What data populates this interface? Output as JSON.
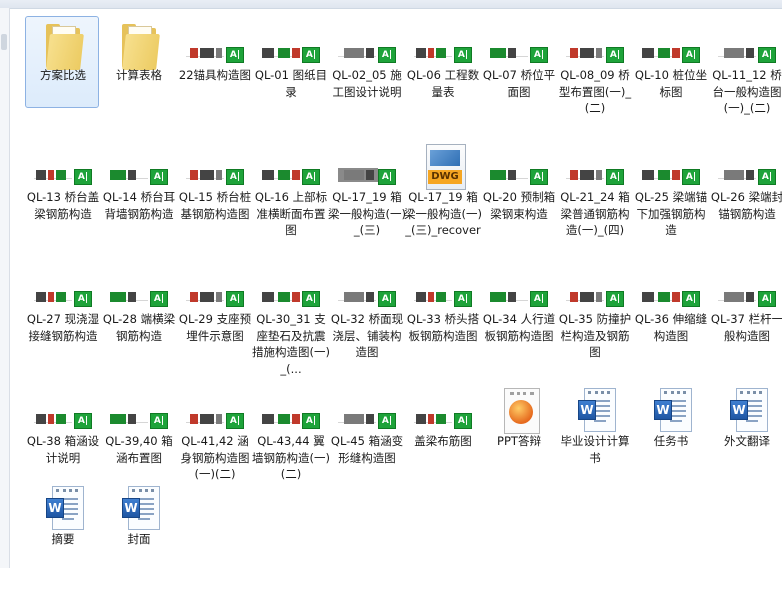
{
  "window": {
    "title": ""
  },
  "items": [
    {
      "label": "方案比选",
      "type": "folder",
      "selected": true
    },
    {
      "label": "计算表格",
      "type": "folder"
    },
    {
      "label": "22锚具构造图",
      "type": "drawing"
    },
    {
      "label": "QL-01 图纸目录",
      "type": "drawing"
    },
    {
      "label": "QL-02_05 施工图设计说明",
      "type": "drawing"
    },
    {
      "label": "QL-06 工程数量表",
      "type": "drawing"
    },
    {
      "label": "QL-07 桥位平面图",
      "type": "drawing"
    },
    {
      "label": "QL-08_09 桥型布置图(一)_(二)",
      "type": "drawing"
    },
    {
      "label": "QL-10 桩位坐标图",
      "type": "drawing"
    },
    {
      "label": "QL-11_12 桥台一般构造图(一)_(二)",
      "type": "drawing"
    },
    {
      "label": "QL-13 桥台盖梁钢筋构造",
      "type": "drawing"
    },
    {
      "label": "QL-14 桥台耳背墙钢筋构造",
      "type": "drawing"
    },
    {
      "label": "QL-15 桥台桩基钢筋构造图",
      "type": "drawing"
    },
    {
      "label": "QL-16 上部标准横断面布置图",
      "type": "drawing"
    },
    {
      "label": "QL-17_19 箱梁一般构造(一)_(三)",
      "type": "drawing"
    },
    {
      "label": "QL-17_19 箱梁一般构造(一)_(三)_recover",
      "type": "dwg",
      "badge": "DWG"
    },
    {
      "label": "QL-20 预制箱梁钢束构造",
      "type": "drawing"
    },
    {
      "label": "QL-21_24 箱梁普通钢筋构造(一)_(四)",
      "type": "drawing"
    },
    {
      "label": "QL-25 梁端锚下加强钢筋构造",
      "type": "drawing"
    },
    {
      "label": "QL-26 梁端封锚钢筋构造",
      "type": "drawing"
    },
    {
      "label": "QL-27 现浇湿接缝钢筋构造",
      "type": "drawing"
    },
    {
      "label": "QL-28 端横梁钢筋构造",
      "type": "drawing"
    },
    {
      "label": "QL-29 支座预埋件示意图",
      "type": "drawing"
    },
    {
      "label": "QL-30_31 支座垫石及抗震措施构造图(一)_(...",
      "type": "drawing"
    },
    {
      "label": "QL-32 桥面现浇层、铺装构造图",
      "type": "drawing"
    },
    {
      "label": "QL-33 桥头搭板钢筋构造图",
      "type": "drawing"
    },
    {
      "label": "QL-34 人行道板钢筋构造图",
      "type": "drawing"
    },
    {
      "label": "QL-35 防撞护栏构造及钢筋图",
      "type": "drawing"
    },
    {
      "label": "QL-36 伸缩缝构造图",
      "type": "drawing"
    },
    {
      "label": "QL-37 栏杆一般构造图",
      "type": "drawing"
    },
    {
      "label": "QL-38 箱涵设计说明",
      "type": "drawing"
    },
    {
      "label": "QL-39,40 箱涵布置图",
      "type": "drawing"
    },
    {
      "label": "QL-41,42 涵身钢筋构造图(一)(二)",
      "type": "drawing"
    },
    {
      "label": "QL-43,44 翼墙钢筋构造(一)(二)",
      "type": "drawing"
    },
    {
      "label": "QL-45 箱涵变形缝构造图",
      "type": "drawing"
    },
    {
      "label": "盖梁布筋图",
      "type": "drawing"
    },
    {
      "label": "PPT答辩",
      "type": "ppt"
    },
    {
      "label": "毕业设计计算书",
      "type": "doc",
      "badge": "W"
    },
    {
      "label": "任务书",
      "type": "doc",
      "badge": "W"
    },
    {
      "label": "外文翻译",
      "type": "doc",
      "badge": "W"
    },
    {
      "label": "摘要",
      "type": "doc",
      "badge": "W"
    },
    {
      "label": "封面",
      "type": "doc",
      "badge": "W"
    }
  ],
  "icons": {
    "folder": "folder-icon",
    "drawing": "cad-drawing-icon",
    "dwg": "dwg-file-icon",
    "ppt": "powerpoint-file-icon",
    "doc": "word-document-icon"
  },
  "drawing_badge": "A|",
  "colors": {
    "selection": "#dcebfb",
    "selection_border": "#8db2e3",
    "cad_badge": "#1ea33a"
  }
}
